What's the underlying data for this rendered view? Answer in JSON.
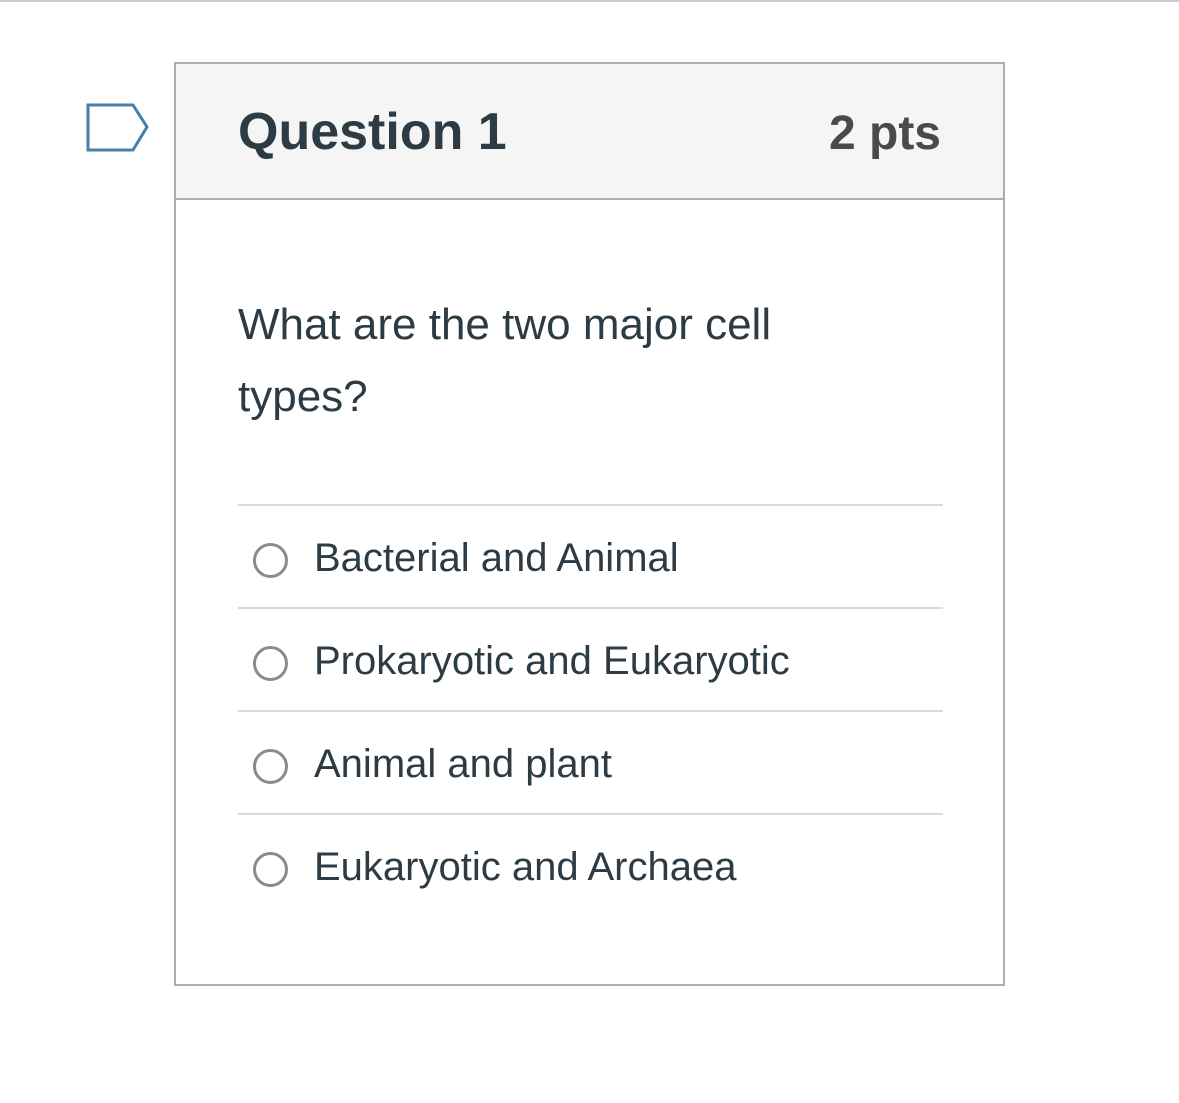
{
  "question": {
    "title": "Question 1",
    "points": "2 pts",
    "text": "What are the two major cell types?",
    "flag_icon": "flag-outline-icon",
    "answers": [
      {
        "label": "Bacterial and Animal",
        "selected": false
      },
      {
        "label": "Prokaryotic and Eukaryotic",
        "selected": false
      },
      {
        "label": "Animal and plant",
        "selected": false
      },
      {
        "label": "Eukaryotic and Archaea",
        "selected": false
      }
    ]
  },
  "colors": {
    "header_bg": "#f5f5f5",
    "border": "#a5afb5",
    "text": "#2d3b45",
    "flag": "#4a7fa8"
  }
}
